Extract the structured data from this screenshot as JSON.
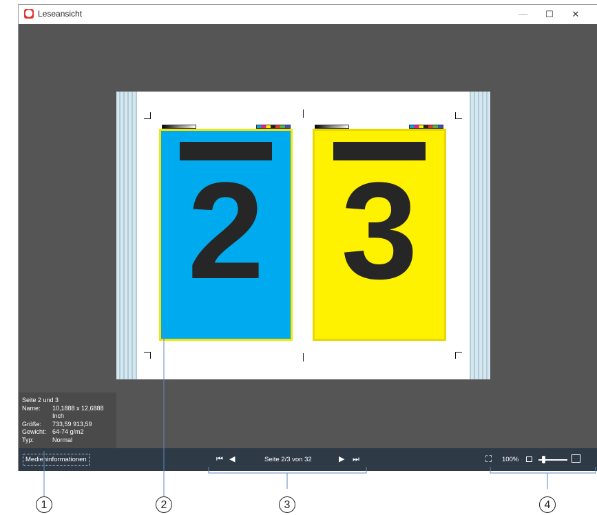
{
  "window": {
    "title": "Leseansicht",
    "minimize_glyph": "—",
    "maximize_glyph": "☐",
    "close_glyph": "✕",
    "app_icon": "acrobat-icon"
  },
  "pages": {
    "left_number": "2",
    "right_number": "3",
    "left_color": "#00aaee",
    "right_color": "#fff200"
  },
  "info_panel": {
    "heading": "Seite 2 und 3",
    "rows": [
      {
        "key": "Name:",
        "value": "10,1888 x 12,6888 Inch"
      },
      {
        "key": "Größe:",
        "value": "733,59 913,59"
      },
      {
        "key": "Gewicht:",
        "value": "64-74 g/m2"
      },
      {
        "key": "Typ:",
        "value": "Normal"
      }
    ]
  },
  "toolbar": {
    "media_info_label": "Medieninformationen",
    "first_glyph": "⏮",
    "prev_glyph": "◀",
    "page_label": "Seite 2/3 von 32",
    "next_glyph": "▶",
    "last_glyph": "⏭",
    "fit_glyph": "⛶",
    "zoom_label": "100%"
  },
  "callouts": [
    "1",
    "2",
    "3",
    "4"
  ]
}
